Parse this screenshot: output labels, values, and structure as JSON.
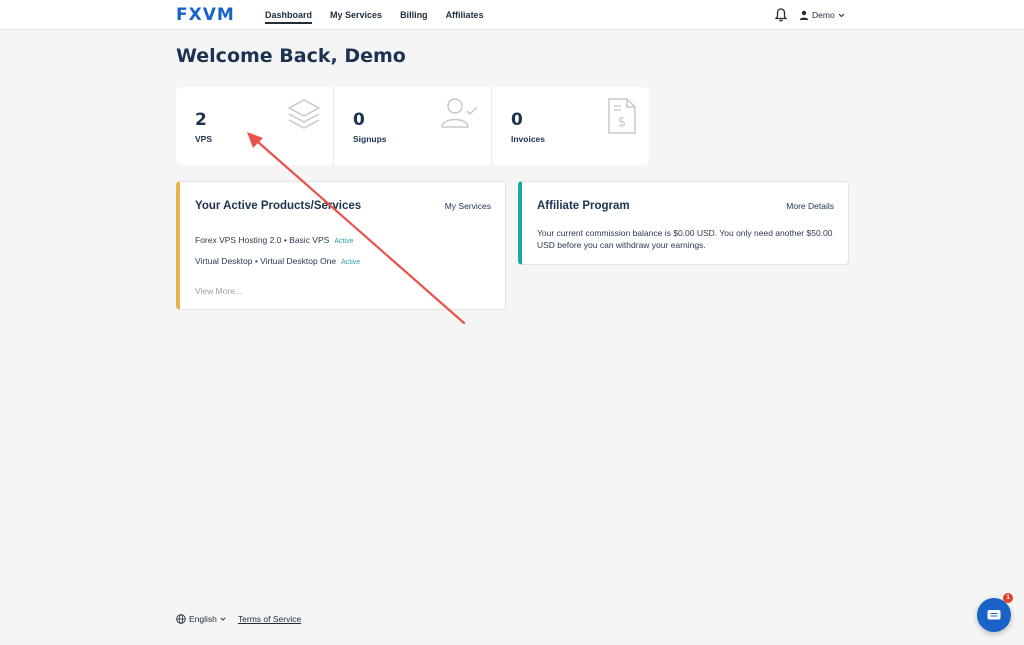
{
  "header": {
    "logo": "FXVM",
    "nav": [
      {
        "label": "Dashboard",
        "active": true
      },
      {
        "label": "My Services",
        "active": false
      },
      {
        "label": "Billing",
        "active": false
      },
      {
        "label": "Affiliates",
        "active": false
      }
    ],
    "user_label": "Demo"
  },
  "welcome": "Welcome Back, Demo",
  "stats": [
    {
      "value": "2",
      "label": "VPS",
      "icon": "layers-icon"
    },
    {
      "value": "0",
      "label": "Signups",
      "icon": "user-check-icon"
    },
    {
      "value": "0",
      "label": "Invoices",
      "icon": "invoice-dollar-icon"
    }
  ],
  "products_card": {
    "title": "Your Active Products/Services",
    "link": "My Services",
    "items": [
      {
        "name": "Forex VPS Hosting 2.0 • Basic VPS",
        "status": "Active"
      },
      {
        "name": "Virtual Desktop • Virtual Desktop One",
        "status": "Active"
      }
    ],
    "view_more": "View More..."
  },
  "affiliate_card": {
    "title": "Affiliate Program",
    "link": "More Details",
    "text": "Your current commission balance is $0.00 USD. You only need another $50.00 USD before you can withdraw your earnings."
  },
  "footer": {
    "language": "English",
    "terms": "Terms of Service"
  },
  "chat": {
    "badge": "1"
  },
  "colors": {
    "brand": "#1a63c6",
    "products_accent": "#e8b34a",
    "affiliate_accent": "#19a8a8",
    "active_status": "#2aa3a3",
    "annotation_arrow": "#e8534a"
  }
}
